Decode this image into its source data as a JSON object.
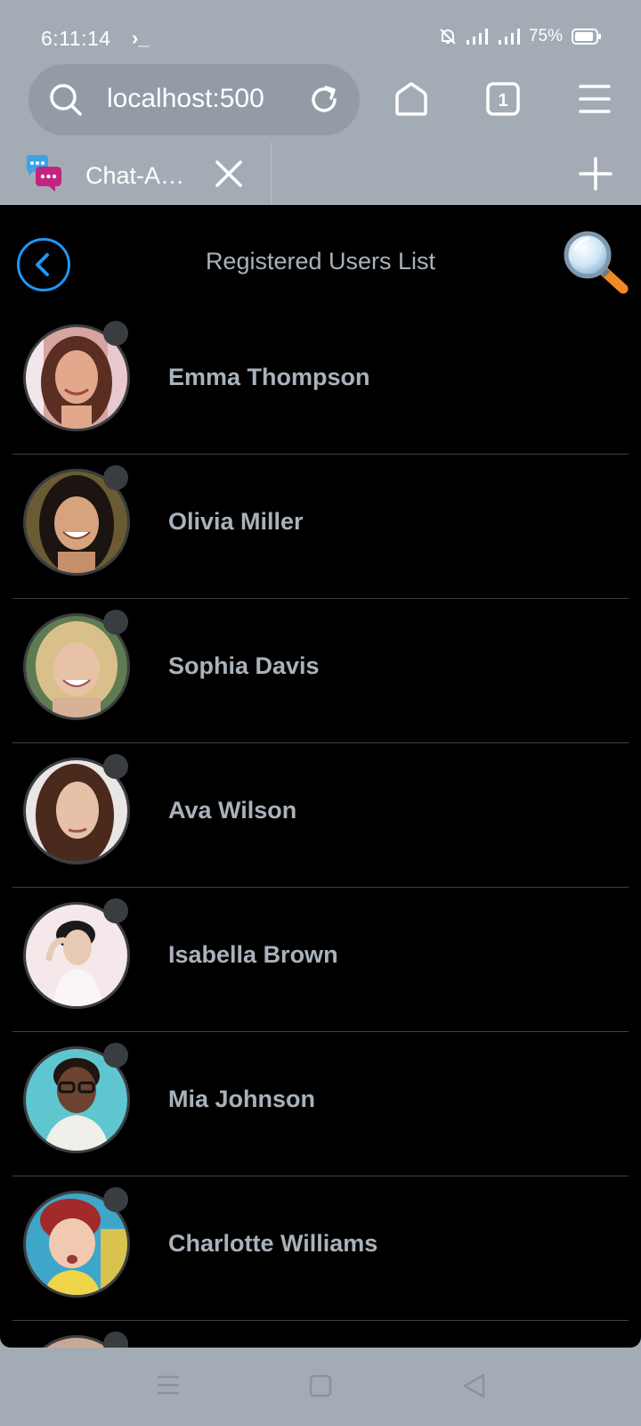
{
  "status_bar": {
    "time": "6:11:14",
    "terminal_glyph": "›_",
    "battery_percent": "75%",
    "icons": [
      "bell-off-icon",
      "signal-icon",
      "signal-icon",
      "battery-icon"
    ]
  },
  "browser": {
    "url": "localhost:500",
    "tab_count": "1",
    "tab_title": "Chat-A…"
  },
  "page": {
    "title": "Registered Users List"
  },
  "users": [
    {
      "name": "Emma Thompson"
    },
    {
      "name": "Olivia Miller"
    },
    {
      "name": "Sophia Davis"
    },
    {
      "name": "Ava Wilson"
    },
    {
      "name": "Isabella Brown"
    },
    {
      "name": "Mia Johnson"
    },
    {
      "name": "Charlotte Williams"
    }
  ],
  "colors": {
    "accent": "#2196f3",
    "name_text": "#a9b2bb",
    "background": "#000000",
    "chrome": "#a3acb5"
  }
}
